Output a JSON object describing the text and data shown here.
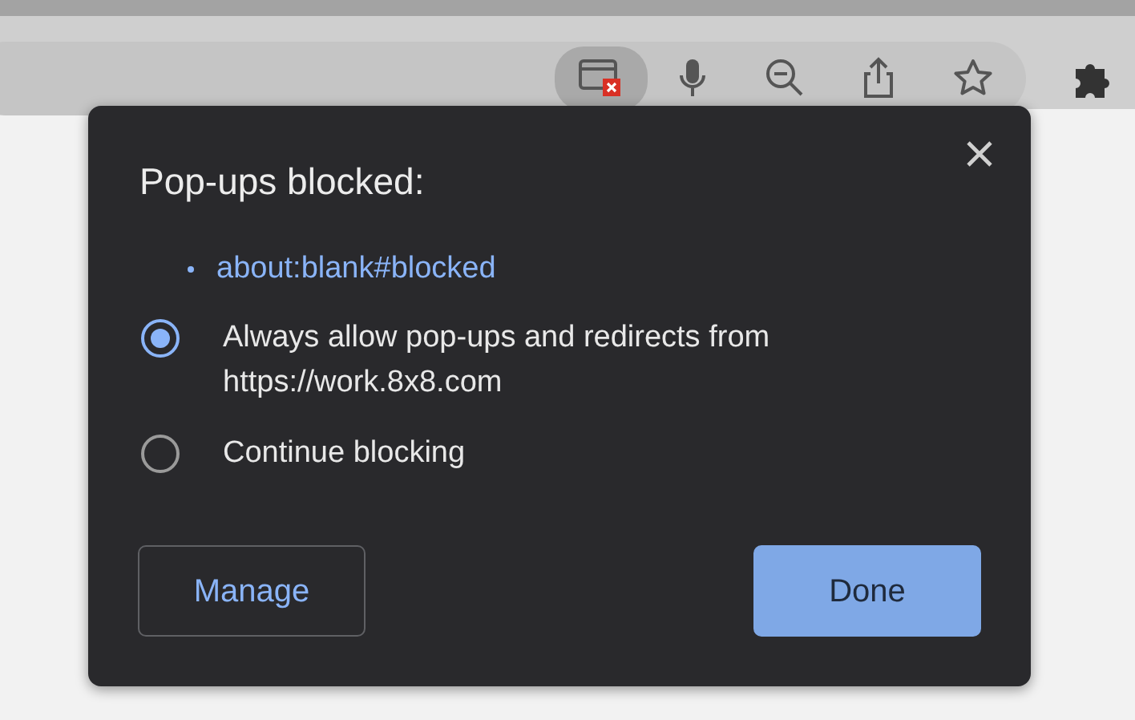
{
  "popup": {
    "title": "Pop-ups blocked:",
    "blocked_links": [
      "about:blank#blocked"
    ],
    "options": [
      {
        "label": "Always allow pop-ups and redirects from https://work.8x8.com",
        "selected": true
      },
      {
        "label": "Continue blocking",
        "selected": false
      }
    ],
    "buttons": [
      {
        "label": "Manage",
        "kind": "outline"
      },
      {
        "label": "Done",
        "kind": "primary"
      }
    ]
  }
}
